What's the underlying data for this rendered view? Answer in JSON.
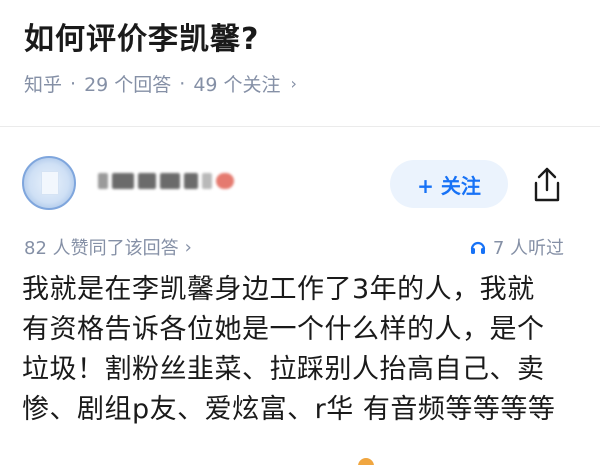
{
  "question": {
    "title": "如何评价李凯馨?",
    "source": "知乎",
    "sep1": "·",
    "answers": "29 个回答",
    "sep2": "·",
    "followers": "49 个关注",
    "chevron": "›"
  },
  "answer": {
    "author_avatar_icon": "avatar-placeholder-icon",
    "follow_label": "+ 关注",
    "share_icon": "share-icon",
    "likes_text": "82 人赞同了该回答",
    "likes_chevron": "›",
    "listen_icon": "headphones-icon",
    "listen_text": "7 人听过",
    "body_lines": [
      "我就是在李凯馨身边工作了3年的人，我就",
      "有资格告诉各位她是一个什么样的人，是个",
      "垃圾！割粉丝韭菜、拉踩别人抬高自己、卖",
      "惨、剧组p友、爱炫富、r华 有音频等等等等"
    ]
  },
  "colors": {
    "accent": "#1772f6",
    "follow_bg": "#ebf3fd",
    "meta_gray": "#8590a6",
    "text": "#1a1a1a"
  }
}
